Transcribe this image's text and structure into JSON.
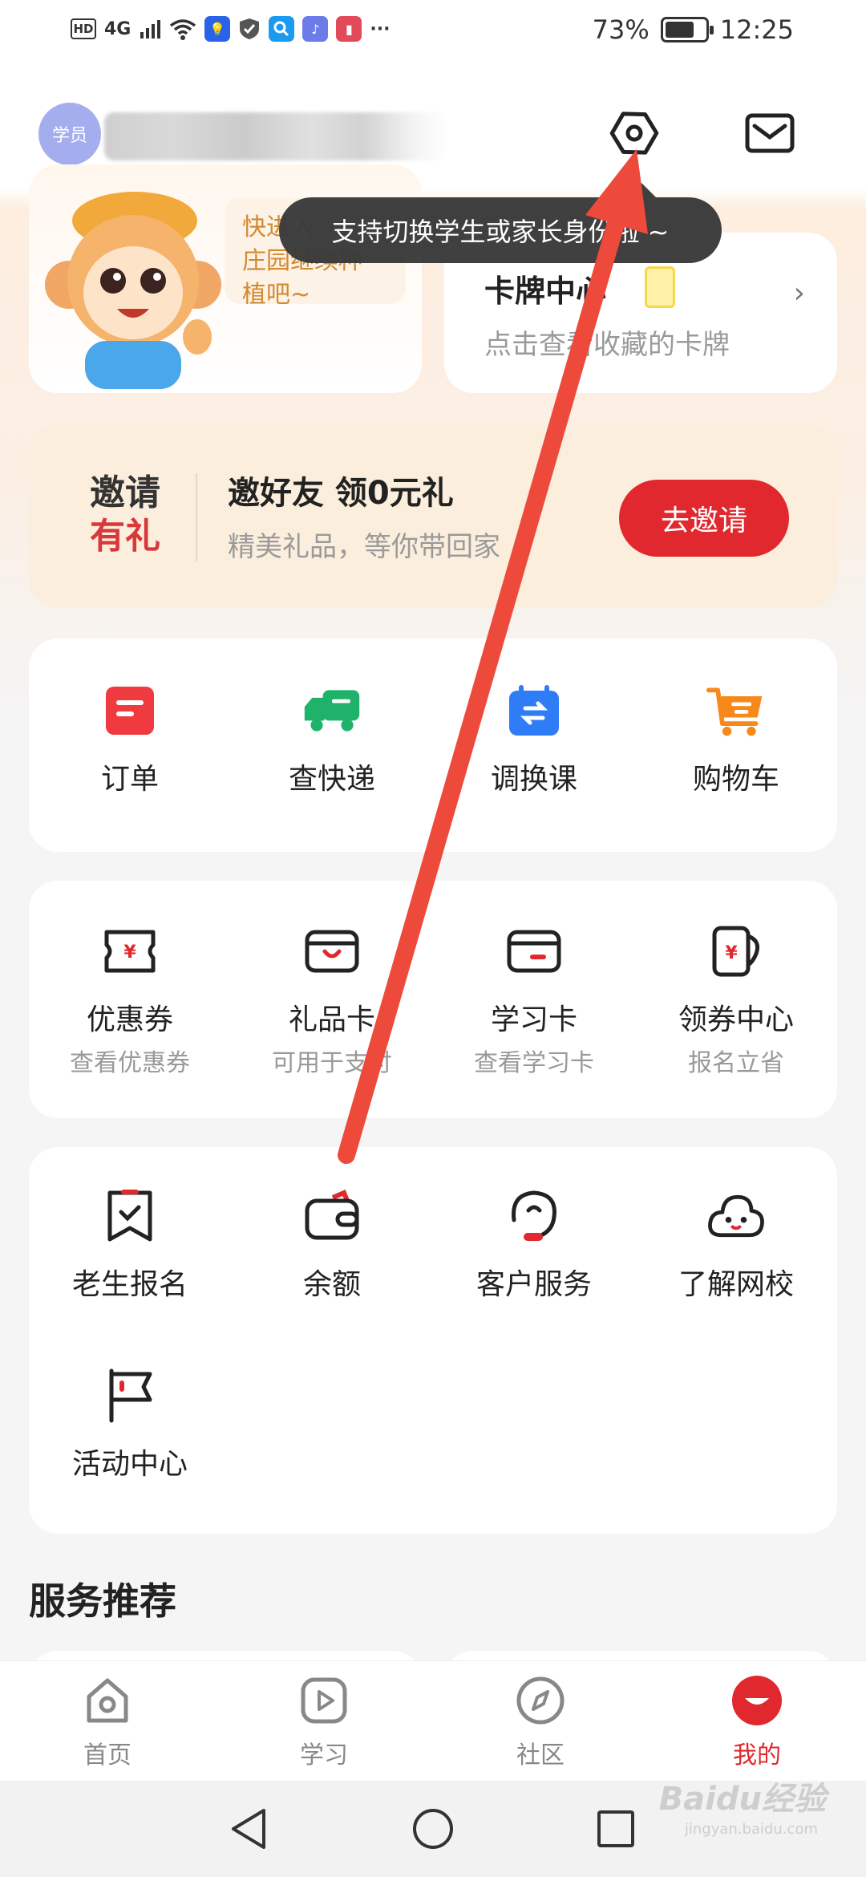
{
  "status_bar": {
    "hd": "HD",
    "network": "4G",
    "battery_percent": "73%",
    "battery_level": 0.73,
    "time": "12:25",
    "more": "···"
  },
  "header": {
    "avatar_label": "学员",
    "settings_icon": "hexagon-settings-icon",
    "message_icon": "envelope-icon"
  },
  "tooltip": "支持切换学生或家长身份啦 ~",
  "mascot_card": {
    "bubble_text": "快进入\n庄园继续种\n植吧~"
  },
  "card_center": {
    "title": "卡牌中心",
    "subtitle": "点击查看收藏的卡牌"
  },
  "invite": {
    "tag_line1": "邀请",
    "tag_line2": "有礼",
    "title": "邀好友 领0元礼",
    "subtitle": "精美礼品，等你带回家",
    "button": "去邀请"
  },
  "quick_actions": [
    {
      "label": "订单",
      "icon": "order-icon"
    },
    {
      "label": "查快递",
      "icon": "truck-icon"
    },
    {
      "label": "调换课",
      "icon": "calendar-swap-icon"
    },
    {
      "label": "购物车",
      "icon": "cart-icon"
    }
  ],
  "wallet_items": [
    {
      "label": "优惠券",
      "sub": "查看优惠券",
      "icon": "coupon-icon"
    },
    {
      "label": "礼品卡",
      "sub": "可用于支付",
      "icon": "gift-card-icon"
    },
    {
      "label": "学习卡",
      "sub": "查看学习卡",
      "icon": "study-card-icon"
    },
    {
      "label": "领券中心",
      "sub": "报名立省",
      "icon": "coupon-center-icon"
    }
  ],
  "services": [
    {
      "label": "老生报名",
      "icon": "bookmark-check-icon"
    },
    {
      "label": "余额",
      "icon": "wallet-icon"
    },
    {
      "label": "客户服务",
      "icon": "headset-icon"
    },
    {
      "label": "了解网校",
      "icon": "cloud-face-icon"
    },
    {
      "label": "活动中心",
      "icon": "flag-icon"
    }
  ],
  "section_title": "服务推荐",
  "tabs": [
    {
      "label": "首页",
      "icon": "home-icon"
    },
    {
      "label": "学习",
      "icon": "play-icon"
    },
    {
      "label": "社区",
      "icon": "compass-icon"
    },
    {
      "label": "我的",
      "icon": "me-icon",
      "active": true
    }
  ],
  "watermark": "Baidu经验",
  "watermark_sub": "jingyan.baidu.com",
  "colors": {
    "accent_red": "#e1282e",
    "invite_bg": "#fbeedd",
    "annotation_arrow": "#ee4a3c"
  }
}
